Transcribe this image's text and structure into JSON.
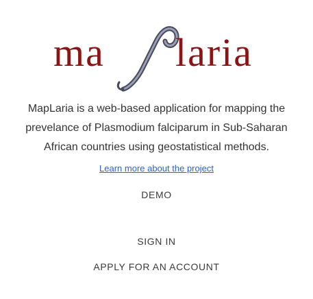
{
  "logo": {
    "text_left": "ma",
    "text_right": "laria",
    "brand_color": "#8b1515",
    "icon": "parasite-spiral-icon"
  },
  "description": "MapLaria is a web-based application for mapping the prevelance of Plasmodium falciparum in Sub-Saharan African countries using geostatistical methods.",
  "learn_more_link": "Learn more about the project",
  "buttons": {
    "demo": "DEMO",
    "sign_in": "SIGN IN",
    "apply": "APPLY FOR AN ACCOUNT"
  },
  "colors": {
    "link": "#2b5fd9",
    "text": "#333333"
  }
}
